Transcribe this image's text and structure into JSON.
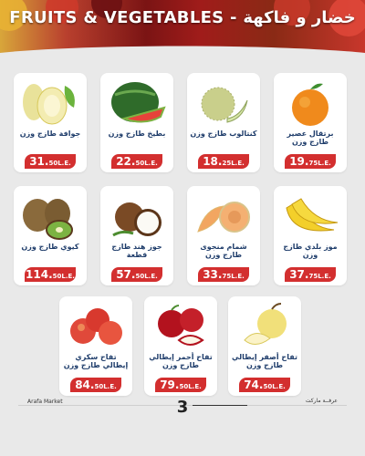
{
  "header": {
    "title": "FRUITS & VEGETABLES - خضار و فاكهة"
  },
  "products": [
    {
      "name": "برتقال عصير طازج وزن",
      "price": "19.",
      "price_small": "75L.E.",
      "icon": "orange-icon"
    },
    {
      "name": "كنتالوب طازج وزن",
      "price": "18.",
      "price_small": "25L.E.",
      "icon": "cantaloupe-icon"
    },
    {
      "name": "بطيخ طازج وزن",
      "price": "22.",
      "price_small": "50L.E.",
      "icon": "watermelon-icon"
    },
    {
      "name": "جوافة طازج وزن",
      "price": "31.",
      "price_small": "50L.E.",
      "icon": "guava-icon"
    },
    {
      "name": "موز بلدي طازج وزن",
      "price": "37.",
      "price_small": "75L.E.",
      "icon": "banana-icon"
    },
    {
      "name": "شمام منجوى طازج وزن",
      "price": "33.",
      "price_small": "75L.E.",
      "icon": "melon-icon"
    },
    {
      "name": "جوز هند طازج قطعة",
      "price": "57.",
      "price_small": "50L.E.",
      "icon": "coconut-icon"
    },
    {
      "name": "كيوي طازج وزن",
      "price": "114.",
      "price_small": "50L.E.",
      "icon": "kiwi-icon"
    },
    {
      "name": "تفاح أصفر إيطالي طازج وزن",
      "price": "74.",
      "price_small": "50L.E.",
      "icon": "yellow-apple-icon"
    },
    {
      "name": "تفاح أحمر إيطالي طازج وزن",
      "price": "79.",
      "price_small": "50L.E.",
      "icon": "red-apple-icon"
    },
    {
      "name": "تفاح سكري إيطالي طازج وزن",
      "price": "84.",
      "price_small": "50L.E.",
      "icon": "sugar-apple-icon"
    }
  ],
  "footer": {
    "left": "Arafa Market",
    "right": "عرفــة ماركت",
    "page": "3"
  },
  "colors": {
    "price_badge": "#d32f2f",
    "name_text": "#1f3d6b"
  }
}
